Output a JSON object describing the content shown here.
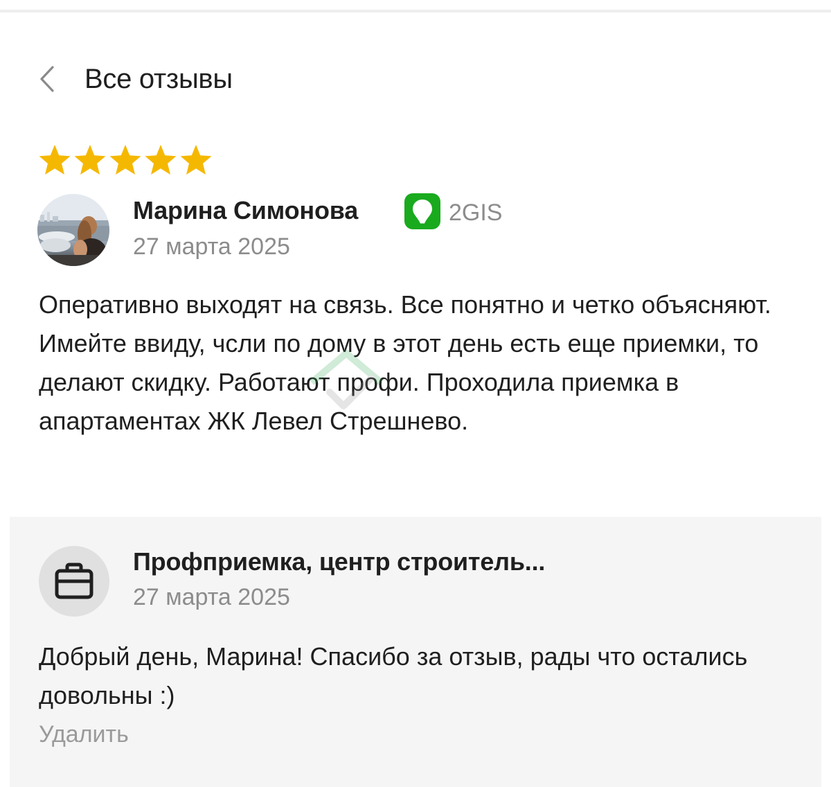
{
  "header": {
    "title": "Все отзывы",
    "back_icon": "chevron-left-icon"
  },
  "review": {
    "rating": 5,
    "rating_max": 5,
    "star_color": "#F5B800",
    "author": "Марина Симонова",
    "source": "2GIS",
    "source_color": "#19AA1E",
    "date": "27 марта 2025",
    "text": "Оперативно выходят на связь. Все понятно и четко объясняют. Имейте ввиду, чсли по дому в этот день есть еще приемки, то делают скидку. Работают профи. Проходила приемка в апартаментах ЖК Левел Стрешнево."
  },
  "reply": {
    "author": "Профприемка, центр строитель...",
    "date": "27 марта 2025",
    "text": "Добрый день, Марина! Спасибо за отзыв, рады что остались довольны :)",
    "delete_label": "Удалить",
    "avatar_icon": "briefcase-icon"
  }
}
